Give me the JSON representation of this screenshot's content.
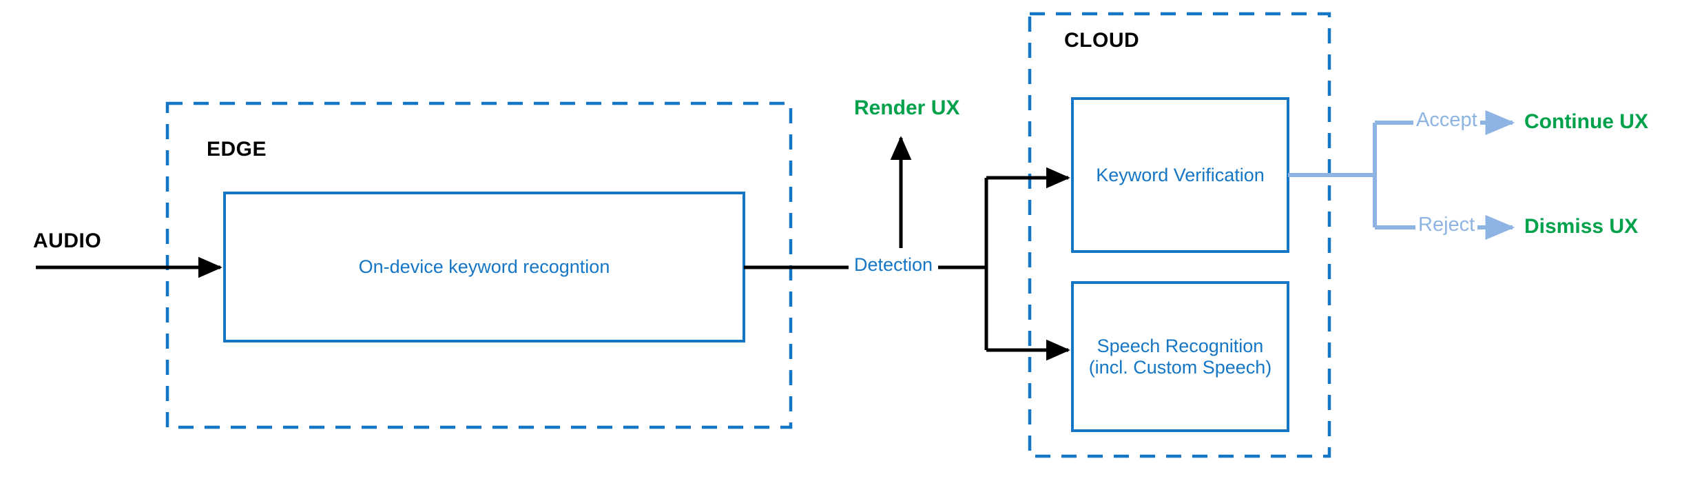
{
  "diagram": {
    "title_hidden": "",
    "zones": [
      {
        "id": "edge",
        "label": "EDGE"
      },
      {
        "id": "cloud",
        "label": "CLOUD"
      }
    ],
    "nodes": [
      {
        "id": "on-device",
        "label": "On-device keyword recogntion"
      },
      {
        "id": "keyword-verification",
        "label": "Keyword Verification"
      },
      {
        "id": "speech-recognition",
        "label": "Speech Recognition\n(incl. Custom Speech)",
        "line1": "Speech Recognition",
        "line2": "(incl. Custom Speech)"
      }
    ],
    "inputs": [
      {
        "id": "audio",
        "label": "AUDIO"
      }
    ],
    "edge_labels": [
      {
        "id": "detection",
        "label": "Detection"
      },
      {
        "id": "accept",
        "label": "Accept"
      },
      {
        "id": "reject",
        "label": "Reject"
      }
    ],
    "outcomes": [
      {
        "id": "render-ux",
        "label": "Render UX"
      },
      {
        "id": "continue-ux",
        "label": "Continue UX"
      },
      {
        "id": "dismiss-ux",
        "label": "Dismiss UX"
      }
    ],
    "colors": {
      "zone_border": "#1576C5",
      "node_border": "#1576C5",
      "node_text": "#1576C5",
      "flow_black": "#000000",
      "flow_light_blue": "#8EB4E3",
      "outcome_green": "#00A14B",
      "label_black": "#000000",
      "background": "#FFFFFF"
    }
  }
}
